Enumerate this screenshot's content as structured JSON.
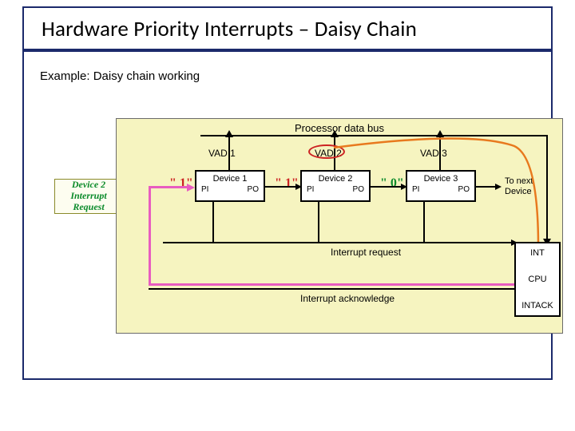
{
  "title": "Hardware Priority Interrupts – Daisy Chain",
  "subtitle": "Example: Daisy chain working",
  "diagram": {
    "bus_label": "Processor data bus",
    "vad": [
      "VAD 1",
      "VAD 2",
      "VAD 3"
    ],
    "devices": [
      {
        "name": "Device 1",
        "pi": "PI",
        "po": "PO",
        "pi_val": "\" 1\""
      },
      {
        "name": "Device 2",
        "pi": "PI",
        "po": "PO",
        "pi_val": "\" 1\""
      },
      {
        "name": "Device 3",
        "pi": "PI",
        "po": "PO",
        "pi_val": "\" 0\""
      }
    ],
    "to_next": "To next\nDevice",
    "irq_label": "Interrupt request",
    "ack_label": "Interrupt acknowledge",
    "cpu": {
      "int": "INT",
      "cpu": "CPU",
      "intack": "INTACK"
    }
  },
  "callout": "Device 2\nInterrupt Request"
}
